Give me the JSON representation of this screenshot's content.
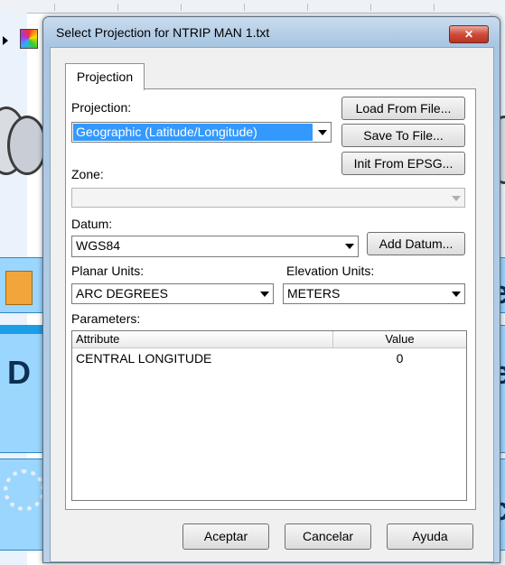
{
  "dialog": {
    "title": "Select Projection for NTRIP MAN 1.txt",
    "close_glyph": "✕",
    "tab_label": "Projection"
  },
  "projection": {
    "label": "Projection:",
    "value": "Geographic (Latitude/Longitude)"
  },
  "buttons": {
    "load_from_file": "Load From File...",
    "save_to_file": "Save To File...",
    "init_from_epsg": "Init From EPSG...",
    "add_datum": "Add Datum...",
    "accept": "Aceptar",
    "cancel": "Cancelar",
    "help": "Ayuda"
  },
  "zone": {
    "label": "Zone:",
    "value": ""
  },
  "datum": {
    "label": "Datum:",
    "value": "WGS84"
  },
  "planar_units": {
    "label": "Planar Units:",
    "value": "ARC DEGREES"
  },
  "elevation_units": {
    "label": "Elevation Units:",
    "value": "METERS"
  },
  "parameters": {
    "label": "Parameters:",
    "columns": [
      "Attribute",
      "Value"
    ],
    "rows": [
      {
        "attribute": "CENTRAL LONGITUDE",
        "value": "0"
      }
    ]
  },
  "background": {
    "text_left_1": "D",
    "text_right_1": "e",
    "text_right_2": "e",
    "text_right_3": "c",
    "icon_names": [
      "grid-icon",
      "seal-icon",
      "gears-icon",
      "folder-icon"
    ]
  },
  "colors": {
    "selection": "#3399ff",
    "titlebar": "#b9d1ea",
    "close_button": "#cf4b3a",
    "background_panel": "#9bd6ff"
  }
}
